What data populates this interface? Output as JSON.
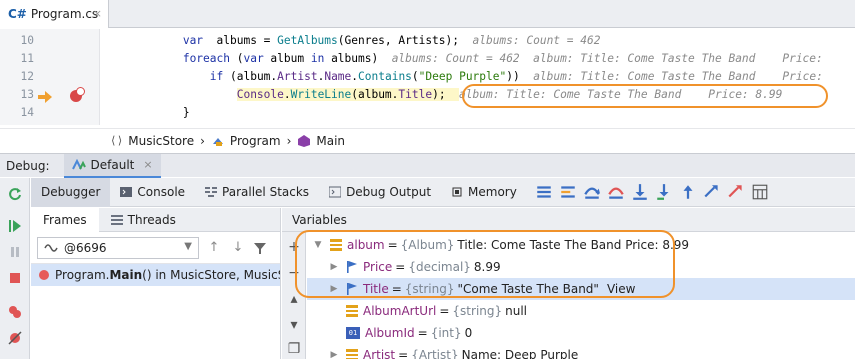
{
  "editor_tab": {
    "lang_badge": "C#",
    "file_name": "Program.cs",
    "close_glyph": "×"
  },
  "code_lines": [
    {
      "num": "10",
      "indent": "            ",
      "parts": [
        [
          "kw",
          "var"
        ],
        [
          "",
          "  albums = "
        ],
        [
          "fn",
          "GetAlbums"
        ],
        [
          "",
          "(Genres, Artists);  "
        ]
      ],
      "hint": "albums: Count = 462"
    },
    {
      "num": "11",
      "indent": "            ",
      "parts": [
        [
          "kw",
          "foreach"
        ],
        [
          "",
          " ("
        ],
        [
          "kw",
          "var"
        ],
        [
          "",
          " album "
        ],
        [
          "kw",
          "in"
        ],
        [
          "",
          " albums)  "
        ]
      ],
      "hint": "albums: Count = 462  album: Title: Come Taste The Band    Price:"
    },
    {
      "num": "12",
      "indent": "                ",
      "parts": [
        [
          "kw",
          "if"
        ],
        [
          "",
          " (album."
        ],
        [
          "id",
          "Artist"
        ],
        [
          "",
          "."
        ],
        [
          "id",
          "Name"
        ],
        [
          "",
          "."
        ],
        [
          "fn",
          "Contains"
        ],
        [
          "",
          "("
        ],
        [
          "str",
          "\"Deep Purple\""
        ],
        [
          "",
          "))  "
        ]
      ],
      "hint": "album: Title: Come Taste The Band    Price:"
    },
    {
      "num": "13",
      "indent": "                    ",
      "parts": [
        [
          "id",
          "Console"
        ],
        [
          "",
          "."
        ],
        [
          "fn",
          "WriteLine"
        ],
        [
          "",
          "(album."
        ],
        [
          "id",
          "Title"
        ],
        [
          "",
          ");  "
        ]
      ],
      "hint": "album: Title: Come Taste The Band    Price: 8.99"
    },
    {
      "num": "14",
      "indent": "            ",
      "parts": [
        [
          "",
          "}"
        ]
      ],
      "hint": ""
    }
  ],
  "breadcrumb": {
    "namespace": "MusicStore",
    "class": "Program",
    "method": "Main",
    "separator": "›"
  },
  "debug_header": {
    "label": "Debug:",
    "session_tab": "Default",
    "close_glyph": "×"
  },
  "debugger_tabs": [
    {
      "label": "Debugger",
      "active": true
    },
    {
      "label": "Console",
      "active": false
    },
    {
      "label": "Parallel Stacks",
      "active": false
    },
    {
      "label": "Debug Output",
      "active": false
    },
    {
      "label": "Memory",
      "active": false
    }
  ],
  "frames_panel": {
    "tabs": [
      {
        "label": "Frames",
        "active": true
      },
      {
        "label": "Threads",
        "active": false
      }
    ],
    "thread_value": "@6696",
    "frame_prefix": "Program.",
    "frame_method": "Main",
    "frame_suffix": "() in MusicStore, MusicStore.d"
  },
  "variables_panel": {
    "title": "Variables",
    "rows": [
      {
        "arrow": "▼",
        "icon": "field-icon",
        "name": "album",
        "type": "{Album}",
        "value": "Title: Come Taste The Band    Price: 8.99"
      },
      {
        "arrow": "▶",
        "icon": "property-icon",
        "name": "Price",
        "type": "{decimal}",
        "value": "8.99"
      },
      {
        "arrow": "▶",
        "icon": "property-icon",
        "name": "Title",
        "type": "{string}",
        "value": "\"Come Taste The Band\"",
        "link": "View"
      },
      {
        "arrow": "",
        "icon": "field-icon",
        "name": "AlbumArtUrl",
        "type": "{string}",
        "value": "null"
      },
      {
        "arrow": "",
        "icon": "int-icon",
        "name": "AlbumId",
        "type": "{int}",
        "value": "0"
      },
      {
        "arrow": "▶",
        "icon": "field-icon",
        "name": "Artist",
        "type": "{Artist}",
        "value": "Name: Deep Purple"
      }
    ]
  },
  "colors": {
    "callout": "#f0922b",
    "selection": "#d5e3f8",
    "keyword": "#1d32a6",
    "accent": "#4a88d8"
  }
}
